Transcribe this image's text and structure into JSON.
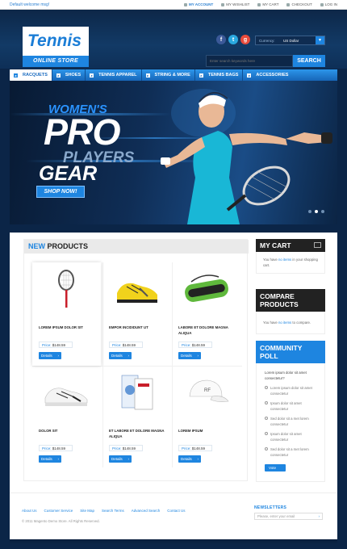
{
  "topbar": {
    "welcome": "Default welcome msg!",
    "links": [
      {
        "label": "MY ACCOUNT",
        "icon": "user-icon"
      },
      {
        "label": "MY WISHLIST",
        "icon": "heart-icon"
      },
      {
        "label": "MY CART",
        "icon": "cart-icon"
      },
      {
        "label": "CHECKOUT",
        "icon": "checkout-icon"
      },
      {
        "label": "LOG IN",
        "icon": "lock-icon"
      }
    ]
  },
  "header": {
    "logo_title": "Tennis",
    "logo_subtitle": "ONLINE STORE",
    "social": [
      {
        "label": "f",
        "color": "#3b5998",
        "icon": "facebook-icon"
      },
      {
        "label": "t",
        "color": "#2aa9e0",
        "icon": "twitter-icon"
      },
      {
        "label": "g",
        "color": "#e94b3b",
        "icon": "google-icon"
      }
    ],
    "currency_label": "Currency:",
    "currency_value": "US Dollar",
    "search_placeholder": "Enter search keywords here",
    "search_button": "SEARCH"
  },
  "nav": {
    "items": [
      "RACQUETS",
      "SHOES",
      "TENNIS APPAREL",
      "STRING & MORE",
      "TENNIS BAGS",
      "ACCESSORIES"
    ],
    "active_index": 0
  },
  "banner": {
    "line1": "WOMEN'S",
    "line2": "PRO",
    "line3": "PLAYERS",
    "line4": "GEAR",
    "button": "SHOP NOW!",
    "slides": 3,
    "active_slide": 1
  },
  "products": {
    "heading_accent": "NEW",
    "heading_rest": " PRODUCTS",
    "price_label": "Price:",
    "details_label": "Details",
    "items": [
      {
        "name": "LOREM IPSUM DOLOR SIT",
        "price": "$148.59",
        "image": "tennis-racquet"
      },
      {
        "name": "EMPOR INCIDIDUNT UT",
        "price": "$148.59",
        "image": "tennis-shoe-yellow"
      },
      {
        "name": "LABORE ET DOLORE MAGNA ALIQUA",
        "price": "$148.59",
        "image": "tennis-bag"
      },
      {
        "name": "DOLOR SIT",
        "price": "$148.59",
        "image": "tennis-shoe-white"
      },
      {
        "name": "ET LABORE ET DOLORE MAGNA ALIQUA",
        "price": "$148.59",
        "image": "tennis-strings"
      },
      {
        "name": "LOREM IPSUM",
        "price": "$148.59",
        "image": "tennis-cap"
      }
    ]
  },
  "sidebar": {
    "cart_title": "MY CART",
    "cart_text_before": "You have ",
    "cart_link": "no items",
    "cart_text_after": " in your shopping cart.",
    "compare_title": "COMPARE PRODUCTS",
    "compare_text_before": "You have ",
    "compare_link": "no items",
    "compare_text_after": " to compare.",
    "poll_title": "COMMUNITY POLL",
    "poll_question": "Lorem ipsum dolor sit amet consectetur?",
    "poll_options": [
      "Lorem ipsum dolor sit amet consectetur",
      "Ipsum dolor sit amet consectetur",
      "Sed dolor sit a met lorem consectetur",
      "Ipsum dolor sit amet consectetur",
      "Sed dolor sit a met lorem consectetur"
    ],
    "vote_button": "Vote"
  },
  "footer": {
    "links": [
      "About Us",
      "Customer Service",
      "Site Map",
      "Search Terms",
      "Advanced Search",
      "Contact Us"
    ],
    "copyright": "© 2011 Magento Demo Store. All Rights Reserved.",
    "newsletter_title": "NEWSLETTERS",
    "newsletter_placeholder": "Please, enter your email"
  },
  "colors": {
    "accent": "#1e85e0",
    "navy": "#0b2547",
    "dark": "#222222"
  }
}
